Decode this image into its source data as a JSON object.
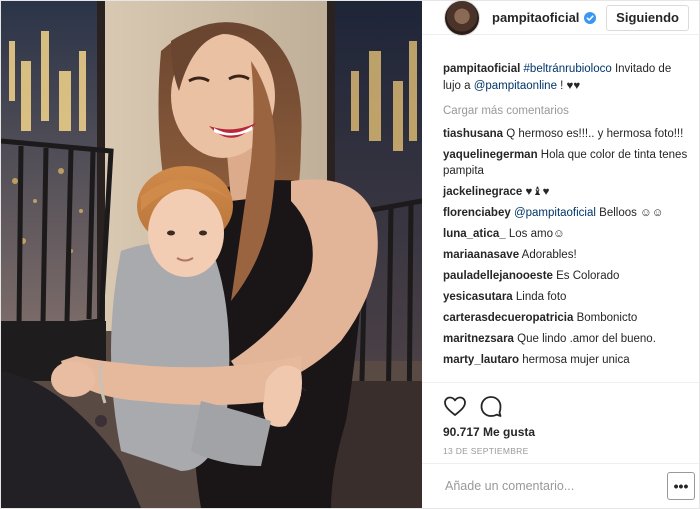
{
  "post": {
    "username": "pampitaoficial",
    "follow_label": "Siguiendo",
    "caption": {
      "username": "pampitaoficial",
      "hashtag": "#beltránrubioloco",
      "text_before_mention": " Invitado de lujo a ",
      "mention": "@pampitaonline",
      "text_after_mention": " ! ♥♥"
    },
    "load_more_label": "Cargar más comentarios",
    "comments": [
      {
        "username": "tiashusana",
        "text": " Q hermoso es!!!.. y hermosa foto!!!"
      },
      {
        "username": "yaquelinegerman",
        "text": " Hola que color de tinta tenes pampita"
      },
      {
        "username": "jackelinegrace",
        "text": " ♥♝♥"
      },
      {
        "username": "florenciabey",
        "mention": "@pampitaoficial",
        "text": " Belloos ☺☺"
      },
      {
        "username": "luna_atica_",
        "text": " Los amo☺"
      },
      {
        "username": "mariaanasave",
        "text": " Adorables!"
      },
      {
        "username": "pauladellejanooeste",
        "text": " Es Colorado"
      },
      {
        "username": "yesicasutara",
        "text": " Linda foto"
      },
      {
        "username": "carterasdecueropatricia",
        "text": " Bombonicto"
      },
      {
        "username": "maritnezsara",
        "text": " Que lindo .amor del bueno."
      },
      {
        "username": "marty_lautaro",
        "text": " hermosa mujer unica"
      }
    ],
    "likes": "90.717 Me gusta",
    "date": "13 DE SEPTIEMBRE",
    "add_comment_placeholder": "Añade un comentario...",
    "more_options_label": "•••"
  },
  "colors": {
    "verified": "#3897f0",
    "link": "#003569",
    "muted": "#999999",
    "text": "#262626",
    "border": "#efefef"
  },
  "icons": {
    "verified": "verified-badge-icon",
    "like": "heart-icon",
    "comment": "comment-bubble-icon",
    "more": "more-options-icon"
  }
}
